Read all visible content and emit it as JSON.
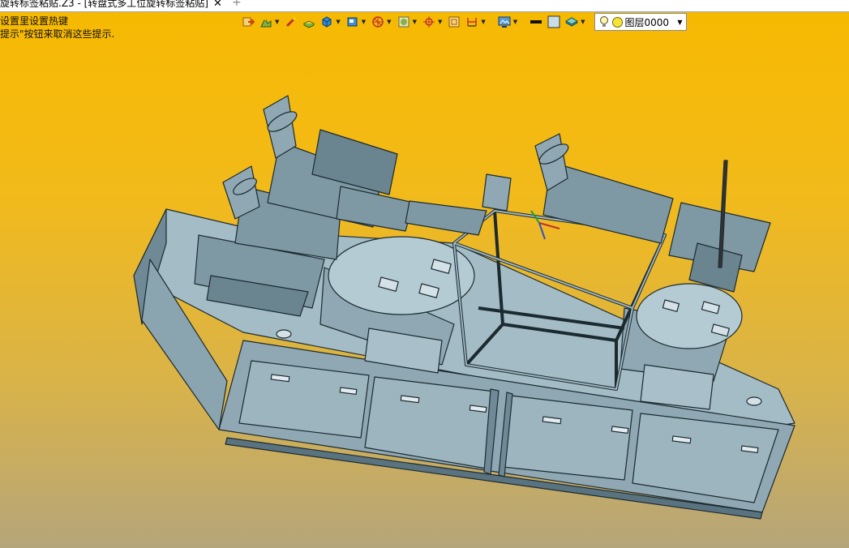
{
  "tab": {
    "title": "旋转标签粘贴.Z3 - [转盘式多工位旋转标签粘贴]",
    "close": "✕",
    "add": "+"
  },
  "hints": [
    "设置里设置热键",
    "提示\"按钮来取消这些提示."
  ],
  "toolbar": {
    "icons": [
      "exit-icon",
      "construction-icon",
      "wand-icon",
      "extrude-icon",
      "cube-icon",
      "view-cube-icon",
      "cross-section-icon",
      "sphere-icon",
      "axis-icon",
      "window-icon",
      "dimension-icon",
      "display-icon",
      "line-color-icon",
      "face-color-icon",
      "layer-stack-icon"
    ],
    "layer_label": "图层0000"
  },
  "colors": {
    "bg_top": "#f7b900",
    "bg_bottom": "#b5a57a",
    "model": "#8fa8b3",
    "edge": "#1c2a30"
  }
}
